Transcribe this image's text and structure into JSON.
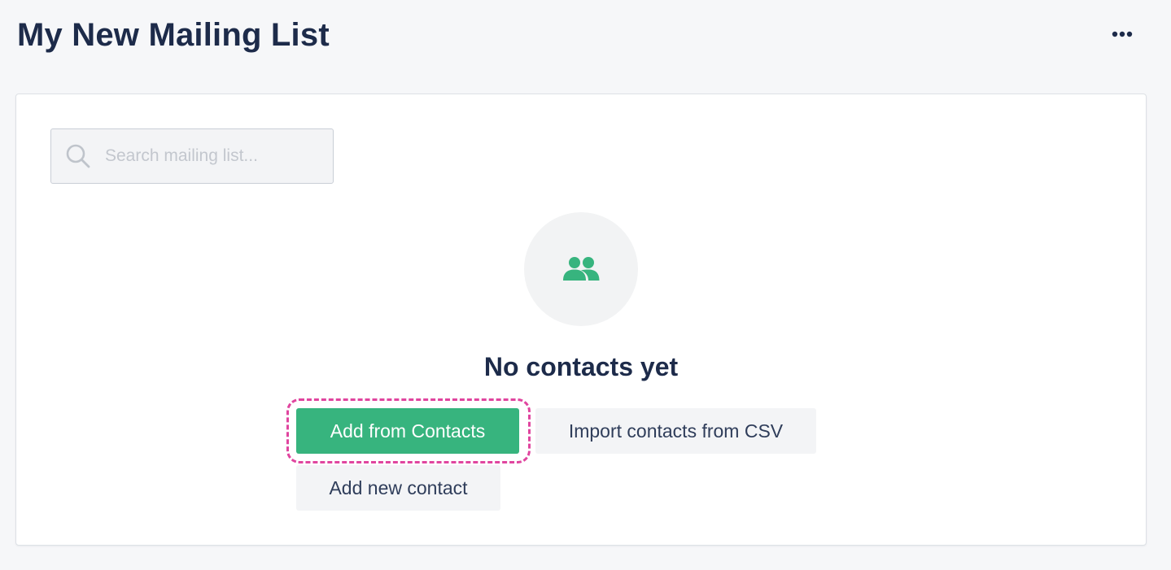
{
  "header": {
    "title": "My New Mailing List",
    "more_icon": "more-horizontal-icon"
  },
  "search": {
    "placeholder": "Search mailing list...",
    "value": "",
    "icon": "search-icon"
  },
  "empty_state": {
    "icon": "contacts-icon",
    "title": "No contacts yet"
  },
  "actions": {
    "add_from_contacts": "Add from Contacts",
    "import_csv": "Import contacts from CSV",
    "add_new_contact": "Add new contact"
  },
  "colors": {
    "primary": "#37b47e",
    "highlight": "#e0459f",
    "title_text": "#1d2b4a",
    "page_background": "#f6f7f9"
  }
}
